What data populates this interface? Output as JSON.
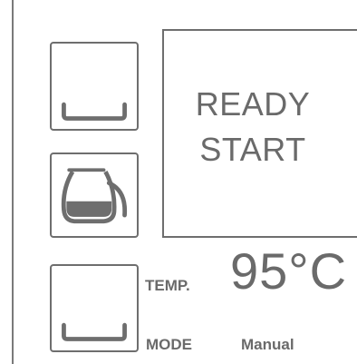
{
  "display": {
    "status_line_1": "READY",
    "status_line_2": "START"
  },
  "temperature": {
    "label": "TEMP.",
    "value": "95°C"
  },
  "mode": {
    "label": "MODE",
    "value": "Manual"
  },
  "buttons": [
    {
      "icon": "tray-icon"
    },
    {
      "icon": "coffee-pot-icon"
    },
    {
      "icon": "tray-icon"
    }
  ],
  "colors": {
    "foreground": "#6a6a6a",
    "border": "#6e6e6e",
    "background": "#ffffff"
  }
}
